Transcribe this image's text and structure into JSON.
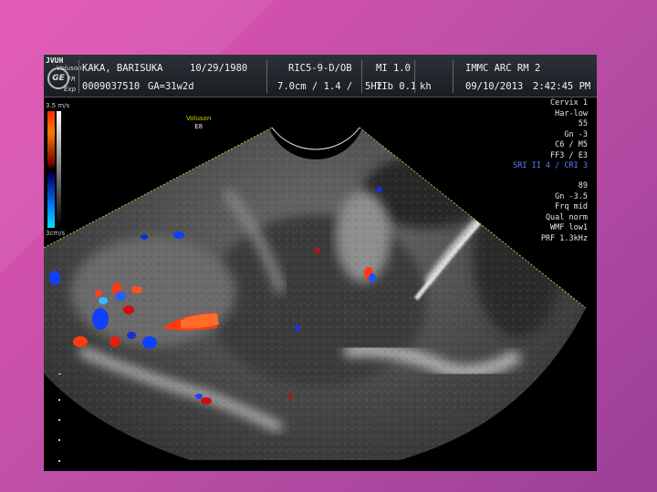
{
  "header": {
    "logo_text": "GE",
    "corner_top": "JVUH",
    "corner_lines": [
      "Voluson",
      "FR",
      "Exp"
    ],
    "patient_name": "KAKA, BARISUKA",
    "dob": "10/29/1980",
    "patient_id": "0009037510",
    "ga": "GA=31w2d",
    "probe": "RIC5-9-D/OB",
    "depth_freq": "7.0cm / 1.4 /",
    "freq": "5Hz",
    "mi": "MI 1.0",
    "tib": "TIb 0.1",
    "operator": "kh",
    "institution": "IMMC ARC RM 2",
    "date": "09/10/2013",
    "time": "2:42:45 PM"
  },
  "left_panel": {
    "scale_top": "3.5 m/s",
    "scale_bottom": "3cm/s"
  },
  "image_label": {
    "line1": "Voluson",
    "line2": "E8"
  },
  "params_top": [
    "Cervix 1",
    "Har-low",
    "55",
    "Gn -3",
    "C6 / M5",
    "FF3 / E3"
  ],
  "params_sri": "SRI II 4 / CRI 3",
  "params_bottom": [
    "89",
    "Gn -3.5",
    "Frq mid",
    "Qual norm",
    "WMF low1",
    "PRF 1.3kHz"
  ],
  "colors": {
    "doppler_red": "#ff3a10",
    "doppler_blue": "#1040ff",
    "sector_line": "#9cd43a"
  }
}
